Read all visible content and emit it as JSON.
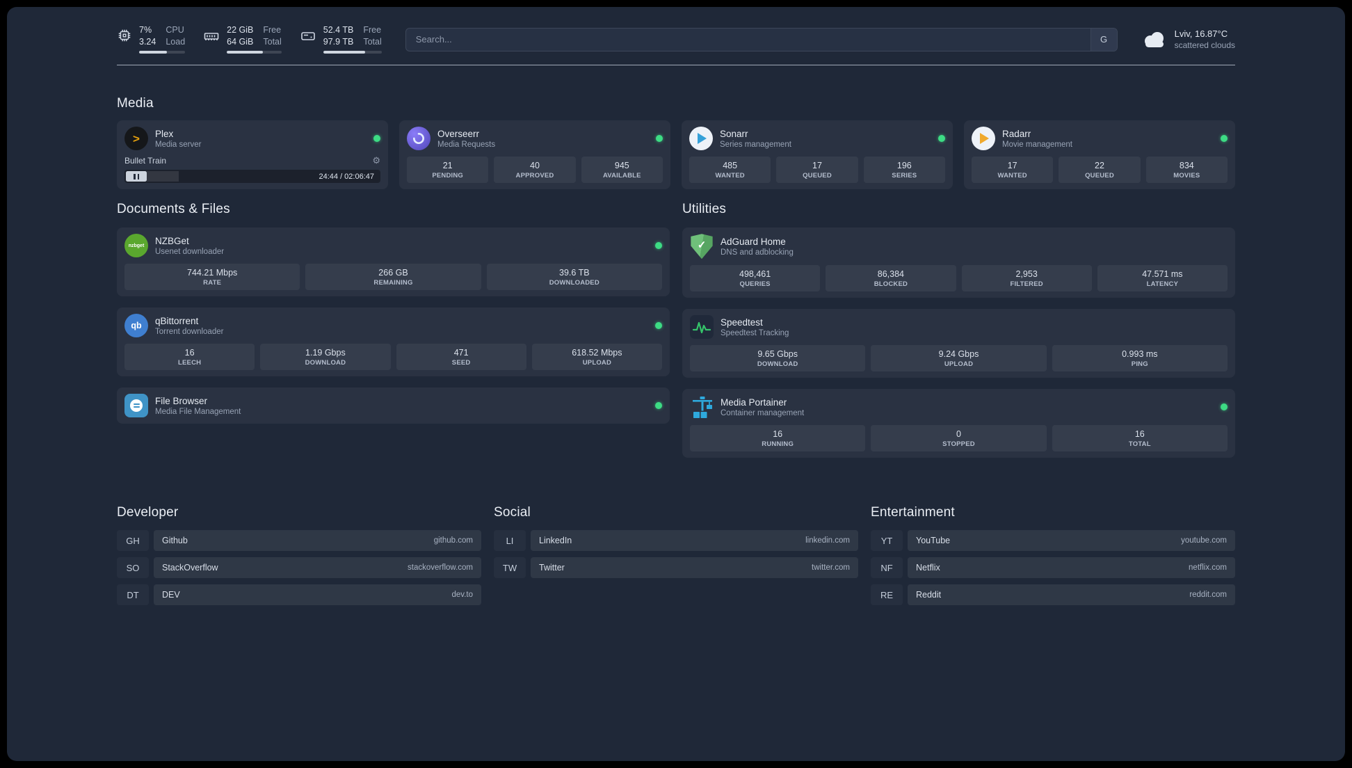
{
  "theme": {
    "background": "#1f2838",
    "status_online": "#3ddc84",
    "accent_plex": "#e5a00d",
    "accent_adguard": "#6fc07a",
    "accent_portainer": "#2ea9dd"
  },
  "icons": {
    "plex_glyph": ">",
    "gear_glyph": "⚙",
    "check_glyph": "✓",
    "nzbget_text": "nzbget",
    "qbittorrent_text": "qb"
  },
  "topbar": {
    "cpu": {
      "percent": "7%",
      "load": "3.24",
      "label_percent": "CPU",
      "label_load": "Load",
      "bar_percent": 60
    },
    "memory": {
      "free": "22 GiB",
      "total": "64 GiB",
      "label_free": "Free",
      "label_total": "Total",
      "bar_percent": 66
    },
    "disk": {
      "free": "52.4 TB",
      "total": "97.9 TB",
      "label_free": "Free",
      "label_total": "Total",
      "bar_percent": 72
    },
    "search": {
      "placeholder": "Search...",
      "provider_button": "G"
    },
    "weather": {
      "location": "Lviv, 16.87°C",
      "condition": "scattered clouds"
    }
  },
  "media": {
    "title": "Media",
    "plex": {
      "name": "Plex",
      "description": "Media server",
      "now_playing": "Bullet Train",
      "time_display": "24:44 / 02:06:47",
      "progress_percent": 19
    },
    "overseerr": {
      "name": "Overseerr",
      "description": "Media Requests",
      "stats": [
        {
          "value": "21",
          "label": "PENDING"
        },
        {
          "value": "40",
          "label": "APPROVED"
        },
        {
          "value": "945",
          "label": "AVAILABLE"
        }
      ]
    },
    "sonarr": {
      "name": "Sonarr",
      "description": "Series management",
      "stats": [
        {
          "value": "485",
          "label": "WANTED"
        },
        {
          "value": "17",
          "label": "QUEUED"
        },
        {
          "value": "196",
          "label": "SERIES"
        }
      ]
    },
    "radarr": {
      "name": "Radarr",
      "description": "Movie management",
      "stats": [
        {
          "value": "17",
          "label": "WANTED"
        },
        {
          "value": "22",
          "label": "QUEUED"
        },
        {
          "value": "834",
          "label": "MOVIES"
        }
      ]
    }
  },
  "documents": {
    "title": "Documents & Files",
    "nzbget": {
      "name": "NZBGet",
      "description": "Usenet downloader",
      "stats": [
        {
          "value": "744.21 Mbps",
          "label": "RATE"
        },
        {
          "value": "266 GB",
          "label": "REMAINING"
        },
        {
          "value": "39.6 TB",
          "label": "DOWNLOADED"
        }
      ]
    },
    "qbittorrent": {
      "name": "qBittorrent",
      "description": "Torrent downloader",
      "stats": [
        {
          "value": "16",
          "label": "LEECH"
        },
        {
          "value": "1.19 Gbps",
          "label": "DOWNLOAD"
        },
        {
          "value": "471",
          "label": "SEED"
        },
        {
          "value": "618.52 Mbps",
          "label": "UPLOAD"
        }
      ]
    },
    "filebrowser": {
      "name": "File Browser",
      "description": "Media File Management"
    }
  },
  "utilities": {
    "title": "Utilities",
    "adguard": {
      "name": "AdGuard Home",
      "description": "DNS and adblocking",
      "stats": [
        {
          "value": "498,461",
          "label": "QUERIES"
        },
        {
          "value": "86,384",
          "label": "BLOCKED"
        },
        {
          "value": "2,953",
          "label": "FILTERED"
        },
        {
          "value": "47.571 ms",
          "label": "LATENCY"
        }
      ]
    },
    "speedtest": {
      "name": "Speedtest",
      "description": "Speedtest Tracking",
      "stats": [
        {
          "value": "9.65 Gbps",
          "label": "DOWNLOAD"
        },
        {
          "value": "9.24 Gbps",
          "label": "UPLOAD"
        },
        {
          "value": "0.993 ms",
          "label": "PING"
        }
      ]
    },
    "portainer": {
      "name": "Media Portainer",
      "description": "Container management",
      "stats": [
        {
          "value": "16",
          "label": "RUNNING"
        },
        {
          "value": "0",
          "label": "STOPPED"
        },
        {
          "value": "16",
          "label": "TOTAL"
        }
      ]
    }
  },
  "bookmarks": {
    "developer": {
      "title": "Developer",
      "items": [
        {
          "abbr": "GH",
          "name": "Github",
          "domain": "github.com"
        },
        {
          "abbr": "SO",
          "name": "StackOverflow",
          "domain": "stackoverflow.com"
        },
        {
          "abbr": "DT",
          "name": "DEV",
          "domain": "dev.to"
        }
      ]
    },
    "social": {
      "title": "Social",
      "items": [
        {
          "abbr": "LI",
          "name": "LinkedIn",
          "domain": "linkedin.com"
        },
        {
          "abbr": "TW",
          "name": "Twitter",
          "domain": "twitter.com"
        }
      ]
    },
    "entertainment": {
      "title": "Entertainment",
      "items": [
        {
          "abbr": "YT",
          "name": "YouTube",
          "domain": "youtube.com"
        },
        {
          "abbr": "NF",
          "name": "Netflix",
          "domain": "netflix.com"
        },
        {
          "abbr": "RE",
          "name": "Reddit",
          "domain": "reddit.com"
        }
      ]
    }
  }
}
